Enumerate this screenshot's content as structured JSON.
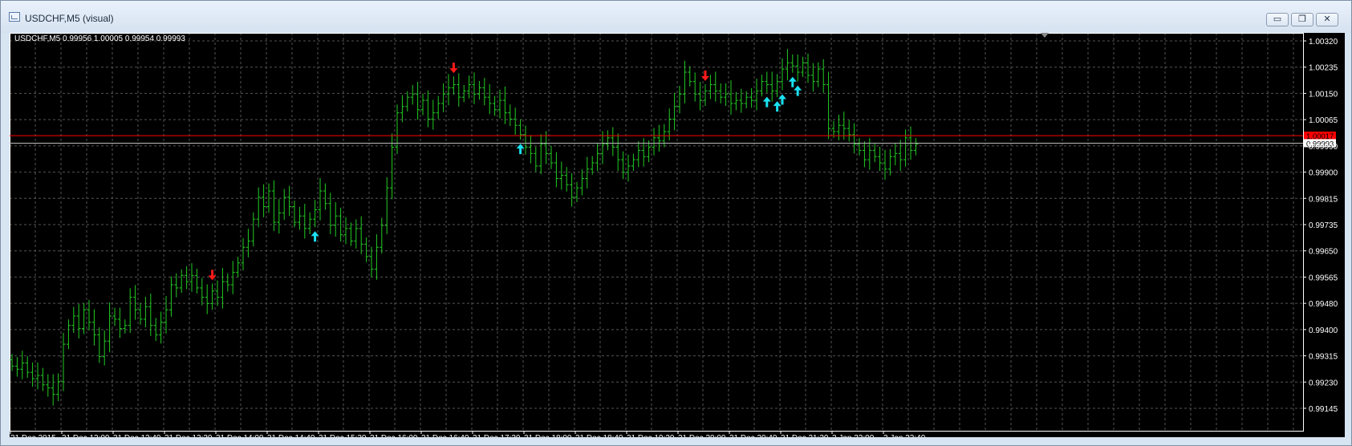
{
  "window": {
    "title": "USDCHF,M5 (visual)",
    "icon": "chart-window-icon",
    "buttons": [
      {
        "name": "minimize-button",
        "glyph": "▭"
      },
      {
        "name": "restore-button",
        "glyph": "❐"
      },
      {
        "name": "close-button",
        "glyph": "✕"
      }
    ]
  },
  "chart_data": {
    "type": "bar",
    "symbol_info": "USDCHF,M5  0.99956 1.00005 0.99954 0.99993",
    "y_ticks": [
      "1.00320",
      "1.00235",
      "1.00150",
      "1.00065",
      "0.99990",
      "0.99900",
      "0.99815",
      "0.99735",
      "0.99650",
      "0.99565",
      "0.99480",
      "0.99400",
      "0.99315",
      "0.99230",
      "0.99145"
    ],
    "ylim": [
      0.99145,
      1.0032
    ],
    "x_ticks": [
      "31 Dec 2015",
      "31 Dec 12:00",
      "31 Dec 12:40",
      "31 Dec 13:20",
      "31 Dec 14:00",
      "31 Dec 14:40",
      "31 Dec 15:20",
      "31 Dec 16:00",
      "31 Dec 16:40",
      "31 Dec 17:20",
      "31 Dec 18:00",
      "31 Dec 18:40",
      "31 Dec 19:20",
      "31 Dec 20:00",
      "31 Dec 20:40",
      "31 Dec 21:20",
      "3 Jan 22:00",
      "3 Jan 22:40"
    ],
    "grid": true,
    "colors": {
      "background": "#000000",
      "bars": "#22cc22",
      "grid": "#555555",
      "axis_text": "#ffffff",
      "sell_arrow": "#ff1a1a",
      "buy_arrow": "#1ae0f0",
      "red_line": "#ff0000",
      "price_line": "#bbbbbb"
    },
    "red_line_price": 1.00017,
    "red_line_label": "1.00017",
    "current_price": 0.99993,
    "current_price_label": "0.99993",
    "bar_step_minutes": 5,
    "closes": [
      0.9928,
      0.9927,
      0.9929,
      0.9926,
      0.9924,
      0.9925,
      0.9922,
      0.9921,
      0.9919,
      0.9923,
      0.9935,
      0.9941,
      0.9944,
      0.994,
      0.9946,
      0.9942,
      0.9938,
      0.9931,
      0.9936,
      0.9944,
      0.9943,
      0.994,
      0.9941,
      0.995,
      0.9946,
      0.9943,
      0.9947,
      0.9941,
      0.9938,
      0.9942,
      0.9946,
      0.9954,
      0.9953,
      0.9957,
      0.9955,
      0.9957,
      0.9953,
      0.995,
      0.9948,
      0.9952,
      0.995,
      0.9955,
      0.9954,
      0.9958,
      0.9961,
      0.9966,
      0.9968,
      0.9975,
      0.9982,
      0.9979,
      0.9984,
      0.9974,
      0.9977,
      0.9982,
      0.9979,
      0.9974,
      0.9976,
      0.9972,
      0.9975,
      0.9978,
      0.9984,
      0.998,
      0.9973,
      0.9976,
      0.997,
      0.9972,
      0.9968,
      0.9972,
      0.9967,
      0.9963,
      0.9959,
      0.9966,
      0.9973,
      0.9985,
      0.9998,
      1.0009,
      1.0011,
      1.0014,
      1.0015,
      1.001,
      1.0013,
      1.0007,
      1.0009,
      1.0012,
      1.0015,
      1.0017,
      1.0018,
      1.0014,
      1.0016,
      1.0018,
      1.0015,
      1.0017,
      1.0014,
      1.0012,
      1.001,
      1.0013,
      1.0009,
      1.0007,
      1.0005,
      1.0002,
      0.9998,
      0.9996,
      0.9992,
      0.9999,
      0.9996,
      0.9993,
      0.9988,
      0.9989,
      0.9986,
      0.9982,
      0.9985,
      0.9988,
      0.9991,
      0.9993,
      0.9996,
      0.9999,
      1.0001,
      0.9998,
      0.9994,
      0.999,
      0.9992,
      0.9994,
      0.9997,
      0.9995,
      0.9998,
      1.0001,
      1.0,
      1.0003,
      1.0007,
      1.0011,
      1.0015,
      1.0022,
      1.0019,
      1.0015,
      1.0013,
      1.0016,
      1.0018,
      1.0016,
      1.0014,
      1.0015,
      1.0012,
      1.0013,
      1.0012,
      1.0014,
      1.0013,
      1.0016,
      1.0019,
      1.0018,
      1.0016,
      1.0019,
      1.0023,
      1.0025,
      1.0024,
      1.0022,
      1.0025,
      1.0021,
      1.0019,
      1.0023,
      1.0018,
      1.0004,
      1.0003,
      1.0005,
      1.0004,
      1.0002,
      0.9999,
      0.9997,
      0.9994,
      0.9997,
      0.9995,
      0.9993,
      0.9991,
      0.9995,
      0.9996,
      0.9994,
      1.0001,
      0.9997,
      0.9999
    ]
  },
  "signals": {
    "sell": [
      39,
      86,
      135
    ],
    "buy": [
      59,
      99,
      147,
      149,
      150,
      152,
      153
    ]
  }
}
